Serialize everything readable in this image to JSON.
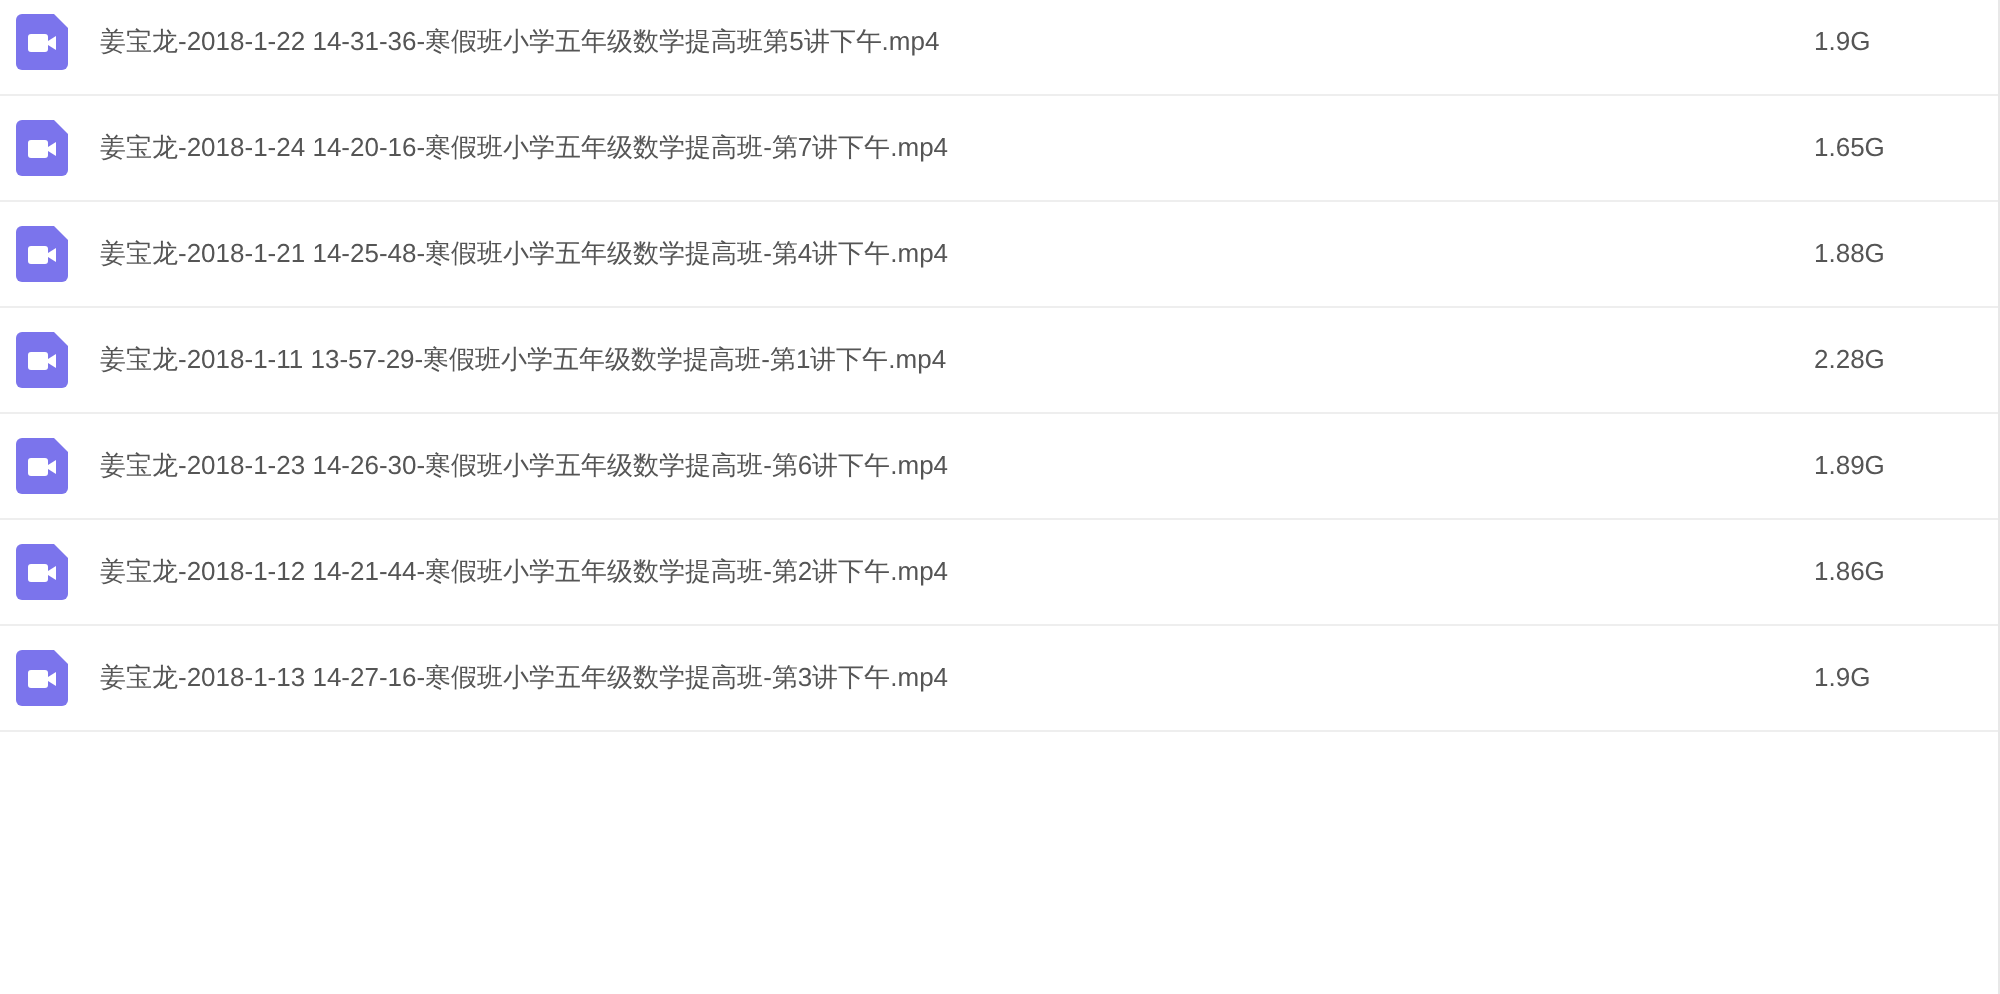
{
  "files": [
    {
      "name": "姜宝龙-2018-1-22 14-31-36-寒假班小学五年级数学提高班第5讲下午.mp4",
      "size": "1.9G"
    },
    {
      "name": "姜宝龙-2018-1-24 14-20-16-寒假班小学五年级数学提高班-第7讲下午.mp4",
      "size": "1.65G"
    },
    {
      "name": "姜宝龙-2018-1-21 14-25-48-寒假班小学五年级数学提高班-第4讲下午.mp4",
      "size": "1.88G"
    },
    {
      "name": "姜宝龙-2018-1-11 13-57-29-寒假班小学五年级数学提高班-第1讲下午.mp4",
      "size": "2.28G"
    },
    {
      "name": "姜宝龙-2018-1-23 14-26-30-寒假班小学五年级数学提高班-第6讲下午.mp4",
      "size": "1.89G"
    },
    {
      "name": "姜宝龙-2018-1-12 14-21-44-寒假班小学五年级数学提高班-第2讲下午.mp4",
      "size": "1.86G"
    },
    {
      "name": "姜宝龙-2018-1-13 14-27-16-寒假班小学五年级数学提高班-第3讲下午.mp4",
      "size": "1.9G"
    }
  ]
}
